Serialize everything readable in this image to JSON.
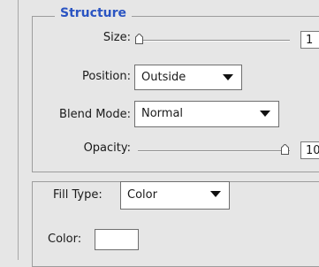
{
  "structure": {
    "title": "Structure",
    "size": {
      "label": "Size:",
      "value": "1",
      "slider_fraction": 0.0
    },
    "position": {
      "label": "Position:",
      "value": "Outside"
    },
    "blend_mode": {
      "label": "Blend Mode:",
      "value": "Normal"
    },
    "opacity": {
      "label": "Opacity:",
      "value": "10",
      "slider_fraction": 1.0
    }
  },
  "fill": {
    "label": "Fill Type:",
    "value": "Color",
    "color_label": "Color:",
    "color_value": "#ffffff"
  },
  "icons": {
    "select_arrow": "chevron-down-icon",
    "slider_thumb": "slider-thumb-icon"
  }
}
